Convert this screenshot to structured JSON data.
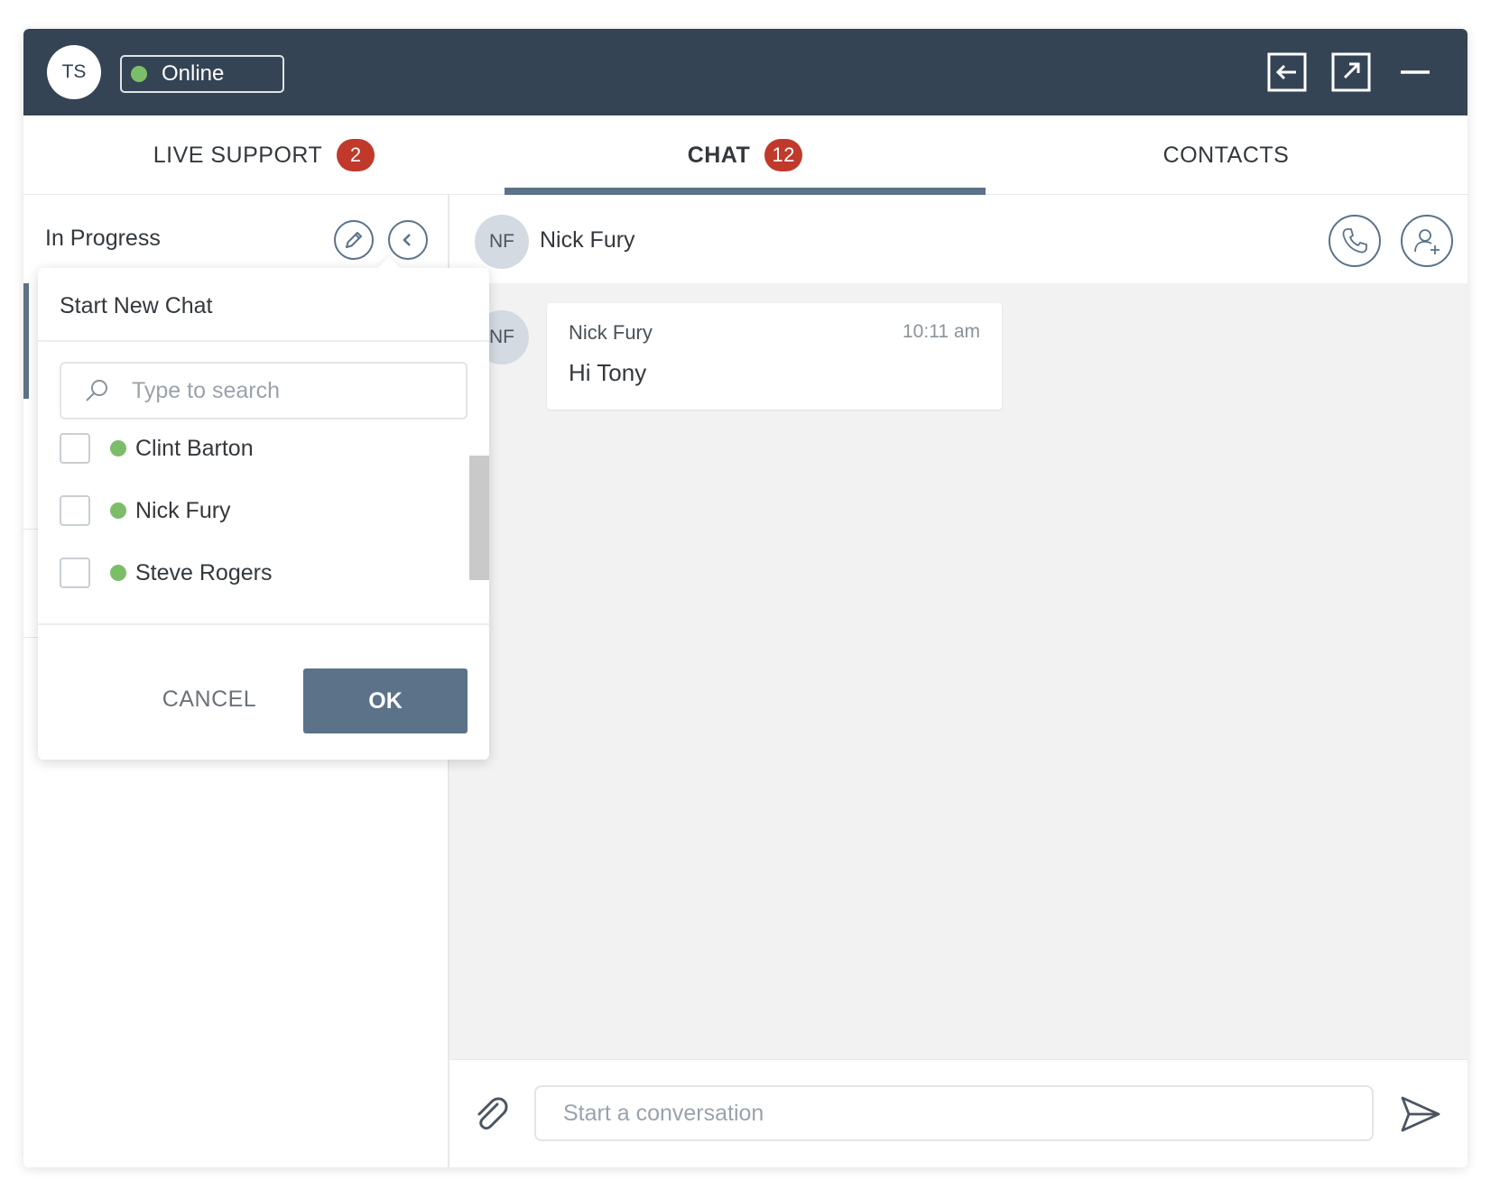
{
  "header": {
    "user_initials": "TS",
    "status_label": "Online",
    "status_color": "#7cbd6a",
    "icons": [
      "dock-left-icon",
      "popout-icon",
      "minimize-icon"
    ]
  },
  "tabs": [
    {
      "label": "LIVE SUPPORT",
      "badge": "2",
      "active": false
    },
    {
      "label": "CHAT",
      "badge": "12",
      "active": true
    },
    {
      "label": "CONTACTS",
      "badge": "",
      "active": false
    }
  ],
  "left_panel": {
    "title": "In Progress",
    "icons": [
      "pencil-icon",
      "chevron-left-icon"
    ]
  },
  "new_chat_popup": {
    "title": "Start New Chat",
    "search_placeholder": "Type to search",
    "contacts": [
      {
        "name": "Clint Barton",
        "status": "online",
        "checked": false
      },
      {
        "name": "Nick Fury",
        "status": "online",
        "checked": false
      },
      {
        "name": "Steve Rogers",
        "status": "online",
        "checked": false
      }
    ],
    "cancel_label": "CANCEL",
    "ok_label": "OK"
  },
  "conversation": {
    "contact_initials": "NF",
    "contact_name": "Nick Fury",
    "icons": [
      "phone-icon",
      "add-user-icon"
    ],
    "messages": [
      {
        "initials": "NF",
        "sender": "Nick Fury",
        "time": "10:11 am",
        "text": "Hi Tony"
      }
    ]
  },
  "composer": {
    "placeholder": "Start a conversation",
    "icons": [
      "paperclip-icon",
      "send-icon"
    ]
  },
  "colors": {
    "header_bg": "#344454",
    "accent": "#5b7289",
    "badge": "#c0392b",
    "online": "#7cbd6a"
  }
}
